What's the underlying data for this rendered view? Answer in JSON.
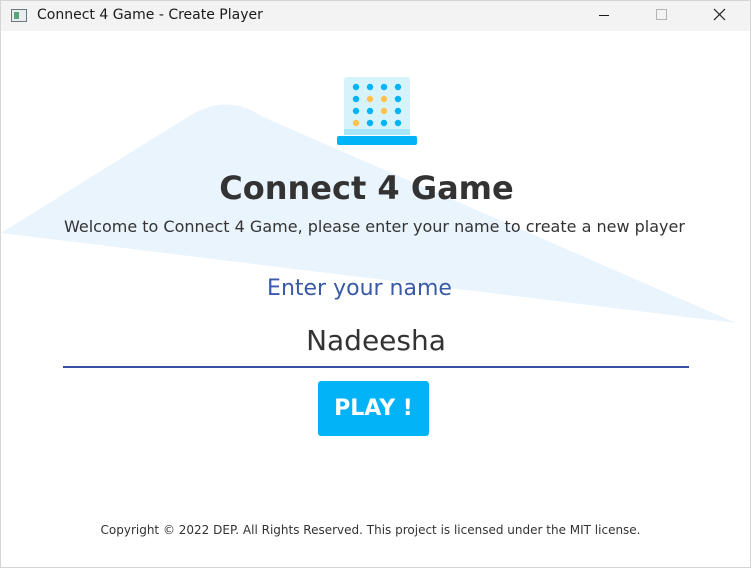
{
  "window": {
    "title": "Connect 4 Game - Create Player",
    "controls": {
      "minimize_icon": "minimize-icon",
      "maximize_icon": "maximize-icon",
      "close_icon": "close-icon"
    }
  },
  "main": {
    "logo_icon": "connect-four-board-icon",
    "heading": "Connect 4 Game",
    "welcome_text": "Welcome to Connect 4 Game, please enter your name to create a new player",
    "name_label": "Enter your name",
    "name_value": "Nadeesha",
    "play_label": "PLAY !"
  },
  "footer": {
    "copyright": "Copyright © 2022 DEP. All Rights Reserved. This project is licensed under the MIT license."
  },
  "colors": {
    "accent": "#03b3f7",
    "label_blue": "#3a5aa8",
    "underline": "#3a4fa0",
    "background_shape": "#eaf4fd",
    "text": "#333333"
  }
}
